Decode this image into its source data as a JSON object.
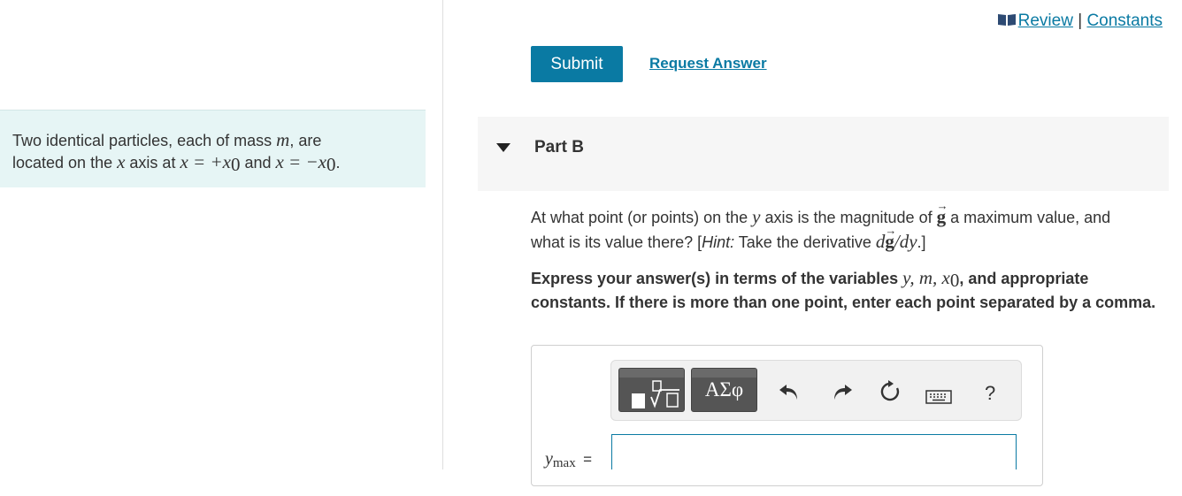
{
  "links": {
    "review": "Review",
    "separator": "|",
    "constants": "Constants"
  },
  "actions": {
    "submit_label": "Submit",
    "request_answer_label": "Request Answer"
  },
  "problem": {
    "t1": "Two identical particles, each of mass ",
    "m": "m",
    "t2": ", are",
    "t3": "located on the ",
    "x1": "x",
    "t4": " axis at ",
    "eq1": "x = +x",
    "eq1_sub": "0",
    "t5": " and ",
    "eq2": "x = −x",
    "eq2_sub": "0",
    "t6": "."
  },
  "part": {
    "title": "Part B"
  },
  "question": {
    "t1": "At what point (or points) on the ",
    "y": "y",
    "t2": " axis is the magnitude of ",
    "g": "g",
    "t3": " a maximum value, and",
    "t4": "what is its value there? [",
    "hint": "Hint:",
    "t5": " Take the derivative ",
    "d": "d",
    "slash_dy": "/dy",
    "t6": ".]"
  },
  "instructions": {
    "t1": "Express your answer(s) in terms of the variables ",
    "vars": "y, m, x",
    "vars_sub": "0",
    "t2": ", and appropriate constants. If there is more than one point, enter each point separated by a comma."
  },
  "toolbar": {
    "symbols_label": "ΑΣφ",
    "help_label": "?"
  },
  "answer": {
    "var": "y",
    "var_sub": "max",
    "equals": "=",
    "value": ""
  },
  "colors": {
    "accent": "#0a7aa3",
    "problem_bg": "#e6f5f5",
    "part_bg": "#f6f6f6"
  }
}
